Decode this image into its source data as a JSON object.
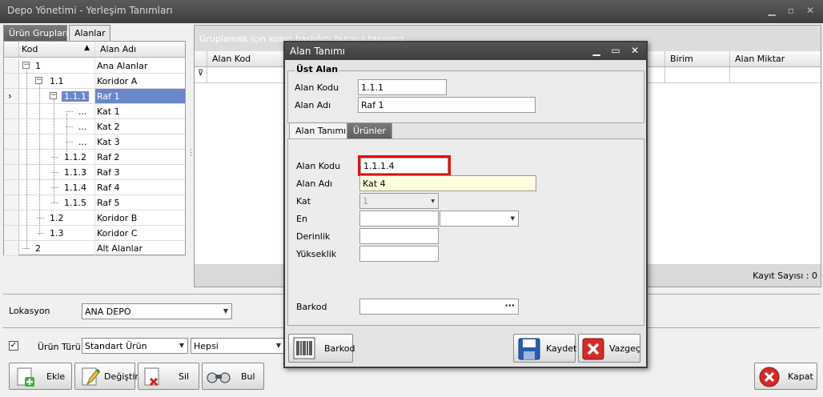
{
  "window": {
    "title": "Depo Yönetimi - Yerleşim Tanımları"
  },
  "left_tabs": [
    "Ürün Grupları",
    "Alanlar"
  ],
  "tree": {
    "columns": [
      "Kod",
      "Alan Adı"
    ],
    "rows": [
      {
        "kod": "1",
        "ad": "Ana Alanlar"
      },
      {
        "kod": "1.1",
        "ad": "Koridor A"
      },
      {
        "kod": "1.1.1",
        "ad": "Raf 1"
      },
      {
        "kod": "...",
        "ad": "Kat 1"
      },
      {
        "kod": "...",
        "ad": "Kat 2"
      },
      {
        "kod": "...",
        "ad": "Kat 3"
      },
      {
        "kod": "1.1.2",
        "ad": "Raf 2"
      },
      {
        "kod": "1.1.3",
        "ad": "Raf 3"
      },
      {
        "kod": "1.1.4",
        "ad": "Raf 4"
      },
      {
        "kod": "1.1.5",
        "ad": "Raf 5"
      },
      {
        "kod": "1.2",
        "ad": "Koridor B"
      },
      {
        "kod": "1.3",
        "ad": "Koridor C"
      },
      {
        "kod": "2",
        "ad": "Alt Alanlar"
      }
    ]
  },
  "grid": {
    "group_hint": "Gruplamak için kolon başlığını buraya taşıyınız",
    "columns": [
      "Alan Kod",
      "Birim",
      "Alan Miktar"
    ],
    "footer": "Kayıt Sayısı : 0"
  },
  "bottom": {
    "lokasyon_label": "Lokasyon",
    "lokasyon_value": "ANA DEPO",
    "urun_turu_label": "Ürün Türü",
    "urun_turu_value": "Standart Ürün",
    "filter_value": "Hepsi",
    "buttons": {
      "ekle": "Ekle",
      "degistir": "Değiştir",
      "sil": "Sil",
      "bul": "Bul",
      "kapat": "Kapat"
    }
  },
  "dialog": {
    "title": "Alan Tanımı",
    "ust_alan": {
      "legend": "Üst Alan",
      "kod_label": "Alan Kodu",
      "kod_value": "1.1.1",
      "ad_label": "Alan Adı",
      "ad_value": "Raf 1"
    },
    "tabs": [
      "Alan Tanımı",
      "Ürünler"
    ],
    "form": {
      "kod_label": "Alan Kodu",
      "kod_value": "1.1.1.4",
      "ad_label": "Alan Adı",
      "ad_value": "Kat 4",
      "kat_label": "Kat",
      "kat_value": "1",
      "en_label": "En",
      "derinlik_label": "Derinlik",
      "yukseklik_label": "Yükseklik",
      "barkod_label": "Barkod",
      "ellipsis": "···"
    },
    "buttons": {
      "barkod": "Barkod",
      "kaydet": "Kaydet",
      "vazgec": "Vazgeç"
    }
  },
  "colors": {
    "selection": "#6b86c9",
    "highlight_border": "#e01010",
    "name_field_bg": "#ffffe0"
  }
}
